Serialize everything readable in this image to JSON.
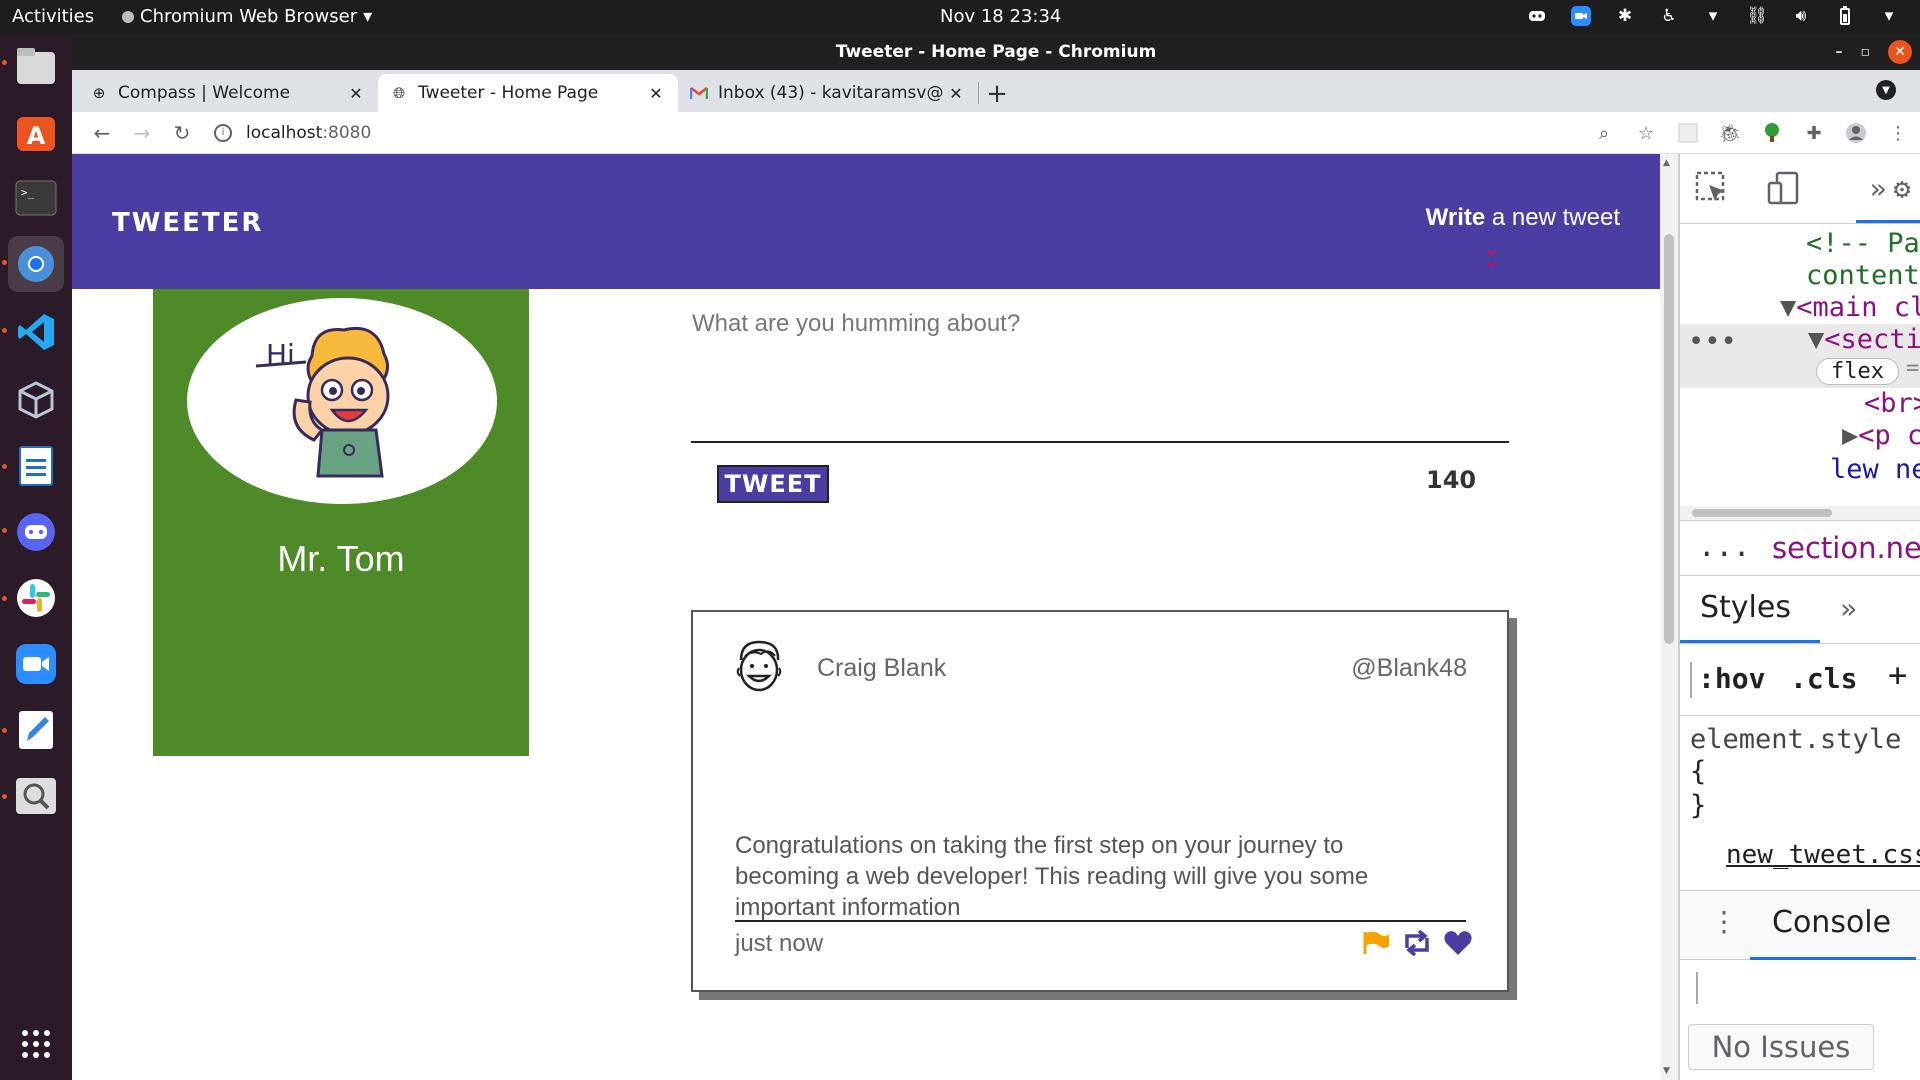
{
  "system_bar": {
    "activities": "Activities",
    "app_menu": "Chromium Web Browser",
    "clock": "Nov 18  23:34"
  },
  "window": {
    "title": "Tweeter - Home Page - Chromium"
  },
  "tabs": [
    {
      "label": "Compass | Welcome",
      "favicon": "compass-icon"
    },
    {
      "label": "Tweeter - Home Page",
      "favicon": "globe-icon"
    },
    {
      "label": "Inbox (43) - kavitaramsv@",
      "favicon": "gmail-icon"
    }
  ],
  "address_bar": {
    "host": "localhost",
    "port": ":8080"
  },
  "page": {
    "brand": "TWEETER",
    "write_bold": "Write",
    "write_rest": " a new tweet",
    "profile_name": "Mr. Tom",
    "avatar_greeting": "Hi",
    "compose_placeholder": "What are you humming about?",
    "tweet_button": "TWEET",
    "char_counter": "140",
    "tweet": {
      "name": "Craig Blank",
      "handle": "@Blank48",
      "body": "Congratulations on taking the first step on your journey to becoming a web developer! This reading will give you some important information",
      "time": "just now",
      "actions": [
        "flag-icon",
        "retweet-icon",
        "heart-icon"
      ]
    },
    "colors": {
      "nav": "#4a3ea3",
      "profile_bg": "#4e8a27",
      "flag": "#f5a300",
      "action_purple": "#4a3ea3"
    }
  },
  "devtools": {
    "dom_lines": {
      "l1": "<!-- Page-s",
      "l2": "content he",
      "l3": "<main class",
      "l4": "<section",
      "flex_badge": "flex",
      "eq": "== $",
      "l6": "<br>",
      "l7": "<p clas",
      "l8": "lew new"
    },
    "breadcrumb_more": "...",
    "breadcrumb": "section.ne",
    "breadcrumb_more2": "...",
    "styles_tab": "Styles",
    "more_tabs": "»",
    "hov": ":hov",
    "cls": ".cls",
    "plus": "+",
    "element_style": "element.style",
    "open_brace": "{",
    "close_brace": "}",
    "stylesheet": "new_tweet.css…",
    "console_tab": "Console",
    "no_issues": "No Issues"
  }
}
